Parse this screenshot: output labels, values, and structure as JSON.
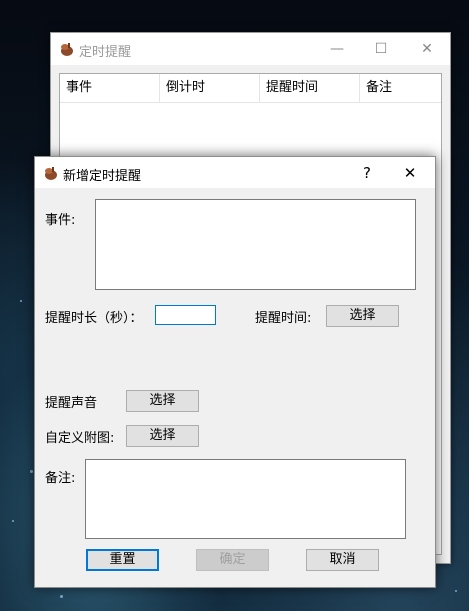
{
  "back_window": {
    "title": "定时提醒",
    "minimize": "—",
    "maximize": "☐",
    "close": "✕",
    "columns": [
      "事件",
      "倒计时",
      "提醒时间",
      "备注"
    ]
  },
  "dialog": {
    "title": "新增定时提醒",
    "help": "?",
    "close": "✕",
    "event_label": "事件:",
    "duration_label": "提醒时长（秒）：",
    "duration_value": "",
    "remind_time_label": "提醒时间:",
    "remind_time_button": "选择",
    "sound_label": "提醒声音",
    "sound_button": "选择",
    "image_label": "自定义附图:",
    "image_button": "选择",
    "note_label": "备注:",
    "reset_button": "重置",
    "ok_button": "确定",
    "cancel_button": "取消"
  }
}
